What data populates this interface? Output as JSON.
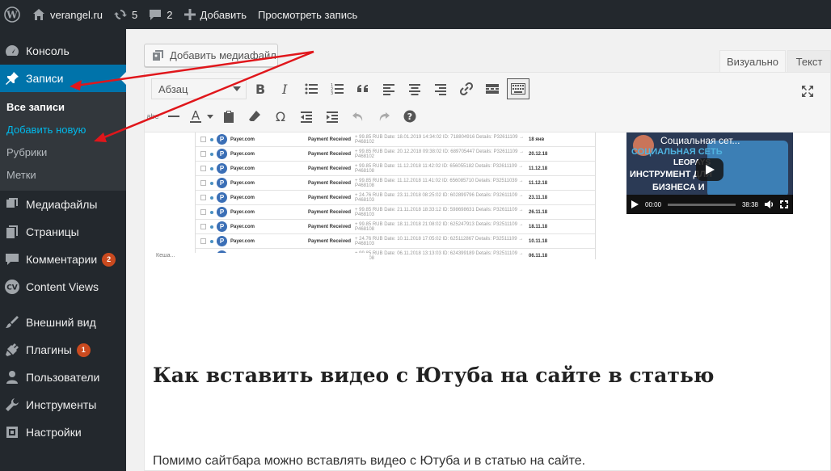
{
  "adminbar": {
    "site_name": "verangel.ru",
    "updates_count": "5",
    "comments_count": "2",
    "add_label": "Добавить",
    "view_post_label": "Просмотреть запись"
  },
  "sidebar": {
    "items": [
      {
        "label": "Консоль",
        "icon": "dashboard-icon"
      },
      {
        "label": "Записи",
        "icon": "pin-icon"
      },
      {
        "label": "Медиафайлы",
        "icon": "media-icon"
      },
      {
        "label": "Страницы",
        "icon": "pages-icon"
      },
      {
        "label": "Комментарии",
        "icon": "comments-icon",
        "badge": "2"
      },
      {
        "label": "Content Views",
        "icon": "cv-icon"
      },
      {
        "label": "Внешний вид",
        "icon": "brush-icon"
      },
      {
        "label": "Плагины",
        "icon": "plugin-icon",
        "badge": "1"
      },
      {
        "label": "Пользователи",
        "icon": "users-icon"
      },
      {
        "label": "Инструменты",
        "icon": "wrench-icon"
      },
      {
        "label": "Настройки",
        "icon": "settings-icon"
      }
    ],
    "submenu": [
      "Все записи",
      "Добавить новую",
      "Рубрики",
      "Метки"
    ]
  },
  "editor": {
    "media_button": "Добавить медиафайл",
    "tab_visual": "Визуально",
    "tab_text": "Текст",
    "format_select": "Абзац",
    "ab_label": "abe"
  },
  "content": {
    "payments": [
      {
        "name": "Payer.com",
        "status": "Payment Received",
        "details": "+ 99.85 RUB Date: 18.01.2019 14:34:02 ID: 718804916 Details: P32611109 → P468102",
        "date": "18 янв"
      },
      {
        "name": "Payer.com",
        "status": "Payment Received",
        "details": "+ 99.85 RUB Date: 20.12.2018 09:38:02 ID: 689705447 Details: P32611109 → P468102",
        "date": "20.12.18"
      },
      {
        "name": "Payer.com",
        "status": "Payment Received",
        "details": "+ 99.85 RUB Date: 11.12.2018 11:42:02 ID: 656055182 Details: P32611109 → P468108",
        "date": "11.12.18"
      },
      {
        "name": "Payer.com",
        "status": "Payment Received",
        "details": "+ 99.85 RUB Date: 11.12.2018 11:41:02 ID: 656085710 Details: P32511039 → P468108",
        "date": "11.12.18"
      },
      {
        "name": "Payer.com",
        "status": "Payment Received",
        "details": "+ 24.76 RUB Date: 23.11.2018 08:25:02 ID: 602899796 Details: P32611109 → P468103",
        "date": "23.11.18"
      },
      {
        "name": "Payer.com",
        "status": "Payment Received",
        "details": "+ 99.85 RUB Date: 21.11.2018 18:33:12 ID: 598698631 Details: P32611109 → P468103",
        "date": "26.11.18"
      },
      {
        "name": "Payer.com",
        "status": "Payment Received",
        "details": "+ 99.85 RUB Date: 18.11.2018 21:08:02 ID: 625247913 Details: P32511109 → P468108",
        "date": "18.11.18"
      },
      {
        "name": "Payer.com",
        "status": "Payment Received",
        "details": "+ 24.76 RUB Date: 10.11.2018 17:05:02 ID: 625112867 Details: P32511109 → P468103",
        "date": "10.11.18"
      },
      {
        "name": "Payer.com",
        "status": "Payment Received",
        "details": "+ 99.85 RUB Date: 06.11.2018 13:13:03 ID: 624399189 Details: P32511109 → P468108",
        "date": "06.11.18"
      }
    ],
    "caption": "Кеша...",
    "video": {
      "title": "Социальная сет...",
      "line1": "СОЦИАЛЬНАЯ СЕТЬ",
      "line2": "LEOPAYS",
      "line3": "ИНСТРУМЕНТ ДЛЯ",
      "line4": "БИЗНЕСА И",
      "time_current": "00:00",
      "time_total": "38:38"
    },
    "heading": "Как вставить видео с Ютуба на сайте в статью",
    "paragraph": "Помимо сайтбара можно вставлять видео с Ютуба и в статью на сайте."
  },
  "colors": {
    "adminbar_bg": "#23282d",
    "active_menu": "#0073aa",
    "badge": "#ca4a1f",
    "arrow": "#e0161b"
  }
}
